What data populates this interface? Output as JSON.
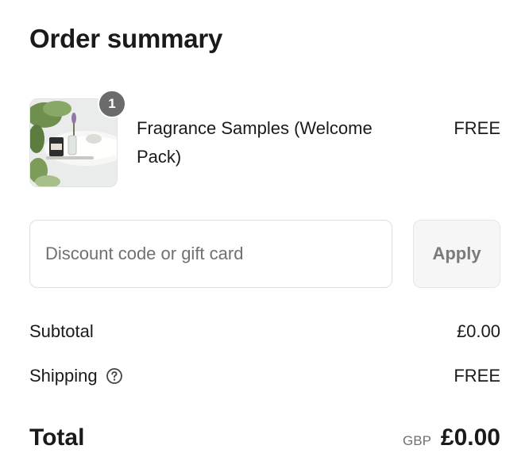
{
  "summary": {
    "title": "Order summary"
  },
  "line_item": {
    "quantity": "1",
    "name": "Fragrance Samples (Welcome Pack)",
    "price": "FREE",
    "image_icon": "product-photo-candle-bathtub"
  },
  "discount": {
    "placeholder": "Discount code or gift card",
    "value": "",
    "apply_label": "Apply"
  },
  "totals": {
    "subtotal_label": "Subtotal",
    "subtotal_value": "£0.00",
    "shipping_label": "Shipping",
    "shipping_value": "FREE",
    "shipping_help_icon": "question-circle-icon",
    "total_label": "Total",
    "currency": "GBP",
    "total_value": "£0.00"
  },
  "colors": {
    "text": "#1a1a1a",
    "muted": "#707070",
    "badge": "#6b6b6b",
    "border": "#dedede",
    "button_bg": "#f6f6f6"
  }
}
